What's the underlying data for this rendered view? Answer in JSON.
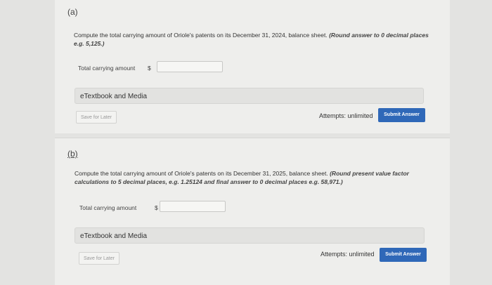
{
  "part_a": {
    "label": "(a)",
    "question": "Compute the total carrying amount of Oriole's patents on its December 31, 2024, balance sheet.",
    "hint": "(Round answer to 0 decimal places e.g. 5,125.)",
    "amount_label": "Total carrying amount",
    "currency": "$",
    "amount_value": "",
    "etextbook": "eTextbook and Media",
    "save_label": "Save for Later",
    "attempts": "Attempts: unlimited",
    "submit_label": "Submit Answer"
  },
  "part_b": {
    "label": "(b)",
    "question": "Compute the total carrying amount of Oriole's patents on its December 31, 2025, balance sheet.",
    "hint": "(Round present value factor calculations to 5 decimal places, e.g. 1.25124 and final answer to 0 decimal places e.g. 58,971.)",
    "amount_label": "Total carrying amount",
    "currency": "$",
    "amount_value": "",
    "etextbook": "eTextbook and Media",
    "save_label": "Save for Later",
    "attempts": "Attempts: unlimited",
    "submit_label": "Submit Answer"
  },
  "colors": {
    "background": "#e3e3e1",
    "panel": "#eeeeec",
    "submit_button": "#2f68b8"
  }
}
